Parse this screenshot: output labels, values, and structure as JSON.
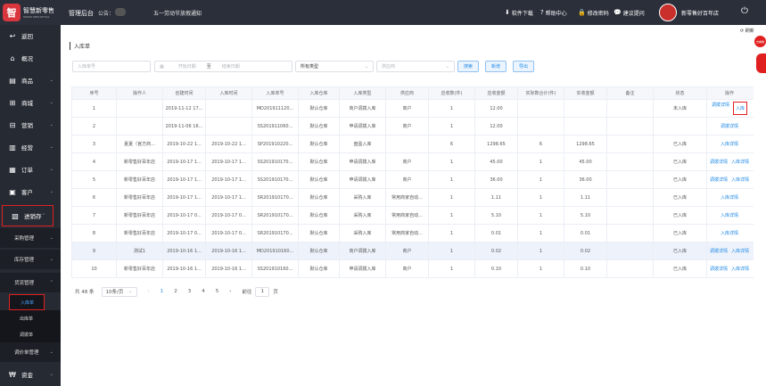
{
  "topbar": {
    "logo_badge": "智",
    "logo_title": "智慧新零售",
    "logo_sub": "SMART NEW RETAIL",
    "app_title": "管理后台",
    "notice_label": "公告：",
    "notice_text": "五一劳动节放假通知",
    "actions": [
      {
        "icon": "download-icon",
        "glyph": "⬇",
        "label": "软件下载"
      },
      {
        "icon": "help-icon",
        "glyph": "?",
        "label": "帮助中心"
      },
      {
        "icon": "lock-icon",
        "glyph": "🔒",
        "label": "修改密码"
      },
      {
        "icon": "chat-icon",
        "glyph": "💬",
        "label": "建议提问"
      }
    ],
    "shop_name": "新零售好百年店",
    "power_glyph": "⏻"
  },
  "sidebar": {
    "items": [
      {
        "name": "back",
        "icon": "back-icon",
        "glyph": "↩",
        "label": "返回",
        "arrow": ""
      },
      {
        "name": "overview",
        "icon": "home-icon",
        "glyph": "⌂",
        "label": "概况",
        "arrow": ""
      },
      {
        "name": "goods",
        "icon": "goods-icon",
        "glyph": "▤",
        "label": "商品",
        "arrow": "⌄"
      },
      {
        "name": "mall",
        "icon": "mall-icon",
        "glyph": "⊞",
        "label": "商城",
        "arrow": "⌄"
      },
      {
        "name": "marketing",
        "icon": "marketing-icon",
        "glyph": "⊟",
        "label": "营销",
        "arrow": "⌄"
      },
      {
        "name": "operation",
        "icon": "chart-icon",
        "glyph": "▥",
        "label": "经营",
        "arrow": "⌄"
      },
      {
        "name": "orders",
        "icon": "order-icon",
        "glyph": "▦",
        "label": "订单",
        "arrow": "⌄"
      },
      {
        "name": "customers",
        "icon": "customer-icon",
        "glyph": "▣",
        "label": "客户",
        "arrow": "⌄"
      },
      {
        "name": "inventory",
        "icon": "inventory-icon",
        "glyph": "▧",
        "label": "进销存",
        "arrow": "⌃"
      }
    ],
    "sub_items": [
      {
        "name": "purchase",
        "label": "采购管理",
        "arrow": "⌄"
      },
      {
        "name": "stock",
        "label": "库存管理",
        "arrow": "⌄"
      },
      {
        "name": "goods-flow",
        "label": "货流管理",
        "arrow": "⌃"
      }
    ],
    "leaves": [
      {
        "name": "inbound",
        "label": "入库单"
      },
      {
        "name": "outbound",
        "label": "出库单"
      },
      {
        "name": "transfer",
        "label": "调拨单"
      }
    ],
    "price_mgmt": {
      "label": "调价单管理",
      "arrow": "⌄"
    },
    "finance": {
      "glyph": "₩",
      "label": "资金",
      "arrow": "⌄"
    }
  },
  "main": {
    "refresh_label": "刷新",
    "float_badge": "去看看",
    "title": "入库单",
    "filters": {
      "order_no_placeholder": "入库单号",
      "start_date_placeholder": "开始日期",
      "date_sep": "至",
      "end_date_placeholder": "结束日期",
      "type_value": "所有类型",
      "supplier_placeholder": "供应商"
    },
    "buttons": {
      "search": "搜索",
      "create": "新增",
      "export": "导出"
    },
    "table": {
      "headers": [
        "序号",
        "操作人",
        "创建时间",
        "入库时间",
        "入库单号",
        "入库仓库",
        "入库类型",
        "供应商",
        "应收数(件)",
        "应收金额",
        "实际数合计(件)",
        "实收金额",
        "备注",
        "状态",
        "操作"
      ],
      "rows": [
        {
          "no": "1",
          "operator": "",
          "created": "2019-11-12 17...",
          "inbound_time": "",
          "order_no": "MD201911120...",
          "warehouse": "默认仓库",
          "type": "商户调拨入库",
          "supplier": "商户",
          "qty": "1",
          "amount": "12.00",
          "act_qty": "",
          "act_amount": "",
          "remark": "",
          "status": "未入库",
          "ops": [
            "调拨详情",
            "入库"
          ]
        },
        {
          "no": "2",
          "operator": "",
          "created": "2019-11-06 16...",
          "inbound_time": "",
          "order_no": "SS201911060...",
          "warehouse": "默认仓库",
          "type": "申请调拨入库",
          "supplier": "商户",
          "qty": "1",
          "amount": "12.00",
          "act_qty": "",
          "act_amount": "",
          "remark": "",
          "status": "",
          "ops": [
            "调拨详情"
          ]
        },
        {
          "no": "3",
          "operator": "夏夏（官方商...",
          "created": "2019-10-22 1...",
          "inbound_time": "2019-10-22 1...",
          "order_no": "SP201910220...",
          "warehouse": "默认仓库",
          "type": "盘盈入库",
          "supplier": "",
          "qty": "6",
          "amount": "1298.65",
          "act_qty": "6",
          "act_amount": "1298.65",
          "remark": "",
          "status": "已入库",
          "ops": [
            "入库详情"
          ]
        },
        {
          "no": "4",
          "operator": "新零售好百年店",
          "created": "2019-10-17 1...",
          "inbound_time": "2019-10-17 1...",
          "order_no": "SS201910170...",
          "warehouse": "默认仓库",
          "type": "申请调拨入库",
          "supplier": "商户",
          "qty": "1",
          "amount": "45.00",
          "act_qty": "1",
          "act_amount": "45.00",
          "remark": "",
          "status": "已入库",
          "ops": [
            "调拨详情",
            "入库详情"
          ]
        },
        {
          "no": "5",
          "operator": "新零售好百年店",
          "created": "2019-10-17 1...",
          "inbound_time": "2019-10-17 1...",
          "order_no": "SS201910170...",
          "warehouse": "默认仓库",
          "type": "申请调拨入库",
          "supplier": "商户",
          "qty": "1",
          "amount": "36.00",
          "act_qty": "1",
          "act_amount": "36.00",
          "remark": "",
          "status": "已入库",
          "ops": [
            "调拨详情",
            "入库详情"
          ]
        },
        {
          "no": "6",
          "operator": "新零售好百年店",
          "created": "2019-10-17 1...",
          "inbound_time": "2019-10-17 1...",
          "order_no": "SR201910170...",
          "warehouse": "默认仓库",
          "type": "采购入库",
          "supplier": "常用商家自动...",
          "qty": "1",
          "amount": "1.11",
          "act_qty": "1",
          "act_amount": "1.11",
          "remark": "",
          "status": "已入库",
          "ops": [
            "入库详情"
          ]
        },
        {
          "no": "7",
          "operator": "新零售好百年店",
          "created": "2019-10-17 0...",
          "inbound_time": "2019-10-17 0...",
          "order_no": "SR201910170...",
          "warehouse": "默认仓库",
          "type": "采购入库",
          "supplier": "常用商家自动...",
          "qty": "1",
          "amount": "5.10",
          "act_qty": "1",
          "act_amount": "5.10",
          "remark": "",
          "status": "已入库",
          "ops": [
            "入库详情"
          ]
        },
        {
          "no": "8",
          "operator": "新零售好百年店",
          "created": "2019-10-17 0...",
          "inbound_time": "2019-10-17 0...",
          "order_no": "SR201910170...",
          "warehouse": "默认仓库",
          "type": "采购入库",
          "supplier": "常用商家自动...",
          "qty": "1",
          "amount": "0.01",
          "act_qty": "1",
          "act_amount": "0.01",
          "remark": "",
          "status": "已入库",
          "ops": [
            "入库详情"
          ]
        },
        {
          "no": "9",
          "operator": "测试1",
          "created": "2019-10-16 1...",
          "inbound_time": "2019-10-16 1...",
          "order_no": "MD201910160...",
          "warehouse": "默认仓库",
          "type": "商户调拨入库",
          "supplier": "商户",
          "qty": "1",
          "amount": "0.02",
          "act_qty": "1",
          "act_amount": "0.02",
          "remark": "",
          "status": "已入库",
          "ops": [
            "调拨详情",
            "入库详情"
          ]
        },
        {
          "no": "10",
          "operator": "新零售好百年店",
          "created": "2019-10-16 1...",
          "inbound_time": "2019-10-16 1...",
          "order_no": "SS201910160...",
          "warehouse": "默认仓库",
          "type": "申请调拨入库",
          "supplier": "商户",
          "qty": "1",
          "amount": "0.10",
          "act_qty": "1",
          "act_amount": "0.10",
          "remark": "",
          "status": "已入库",
          "ops": [
            "调拨详情",
            "入库详情"
          ]
        }
      ]
    },
    "pagination": {
      "total": "共 48 条",
      "page_size": "10条/页",
      "pages": [
        "1",
        "2",
        "3",
        "4",
        "5"
      ],
      "current": "1",
      "prev": "‹",
      "next": "›",
      "goto_prefix": "前往",
      "goto_value": "1",
      "goto_suffix": "页"
    }
  },
  "colors": {
    "accent": "#1e88e5",
    "highlight": "#e02020",
    "sidebar": "#262a33",
    "topbar": "#2b2f3a"
  }
}
